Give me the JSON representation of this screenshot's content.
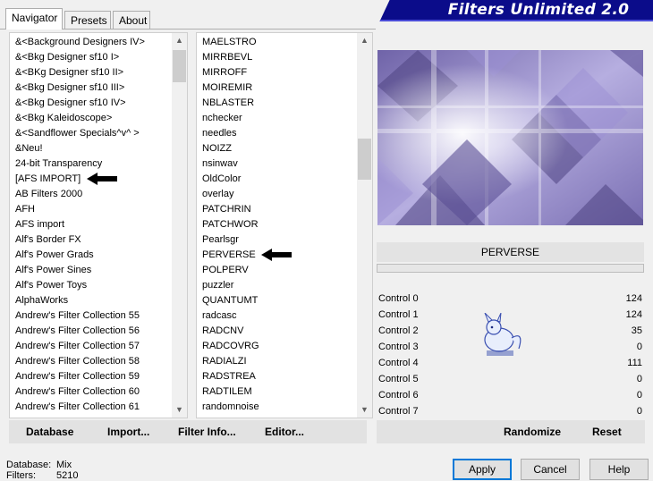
{
  "banner": {
    "title": "Filters Unlimited 2.0"
  },
  "tabs": [
    {
      "label": "Navigator",
      "active": true
    },
    {
      "label": "Presets",
      "active": false
    },
    {
      "label": "About",
      "active": false
    }
  ],
  "categories": [
    "&<Background Designers IV>",
    "&<Bkg Designer sf10 I>",
    "&<BKg Designer sf10 II>",
    "&<Bkg Designer sf10 III>",
    "&<Bkg Designer sf10 IV>",
    "&<Bkg Kaleidoscope>",
    "&<Sandflower Specials^v^ >",
    "&Neu!",
    "24-bit Transparency",
    "[AFS IMPORT]",
    "AB Filters 2000",
    "AFH",
    "AFS import",
    "Alf's Border FX",
    "Alf's Power Grads",
    "Alf's Power Sines",
    "Alf's Power Toys",
    "AlphaWorks",
    "Andrew's Filter Collection 55",
    "Andrew's Filter Collection 56",
    "Andrew's Filter Collection 57",
    "Andrew's Filter Collection 58",
    "Andrew's Filter Collection 59",
    "Andrew's Filter Collection 60",
    "Andrew's Filter Collection 61"
  ],
  "filters": [
    "MAELSTRO",
    "MIRRBEVL",
    "MIRROFF",
    "MOIREMIR",
    "NBLASTER",
    "nchecker",
    "needles",
    "NOIZZ",
    "nsinwav",
    "OldColor",
    "overlay",
    "PATCHRIN",
    "PATCHWOR",
    "Pearlsgr",
    "PERVERSE",
    "POLPERV",
    "puzzler",
    "QUANTUMT",
    "radcasc",
    "RADCNV",
    "RADCOVRG",
    "RADIALZI",
    "RADSTREA",
    "RADTILEM",
    "randomnoise"
  ],
  "selected_category": "[AFS IMPORT]",
  "selected_filter": "PERVERSE",
  "filter_name": "PERVERSE",
  "controls": [
    {
      "label": "Control 0",
      "value": "124"
    },
    {
      "label": "Control 1",
      "value": "124"
    },
    {
      "label": "Control 2",
      "value": "35"
    },
    {
      "label": "Control 3",
      "value": "0"
    },
    {
      "label": "Control 4",
      "value": "111"
    },
    {
      "label": "Control 5",
      "value": "0"
    },
    {
      "label": "Control 6",
      "value": "0"
    },
    {
      "label": "Control 7",
      "value": "0"
    }
  ],
  "toolbar": {
    "database": "Database",
    "import": "Import...",
    "filter_info": "Filter Info...",
    "editor": "Editor...",
    "randomize": "Randomize",
    "reset": "Reset"
  },
  "status": {
    "database_label": "Database:",
    "database_value": "Mix",
    "filters_label": "Filters:",
    "filters_value": "5210"
  },
  "buttons": {
    "apply": "Apply",
    "cancel": "Cancel",
    "help": "Help"
  },
  "colors": {
    "banner": "#0b0c8a",
    "preview_lavender": "#8a7fc4",
    "preview_dark": "#5b4f8f",
    "pointer": "#000000"
  }
}
